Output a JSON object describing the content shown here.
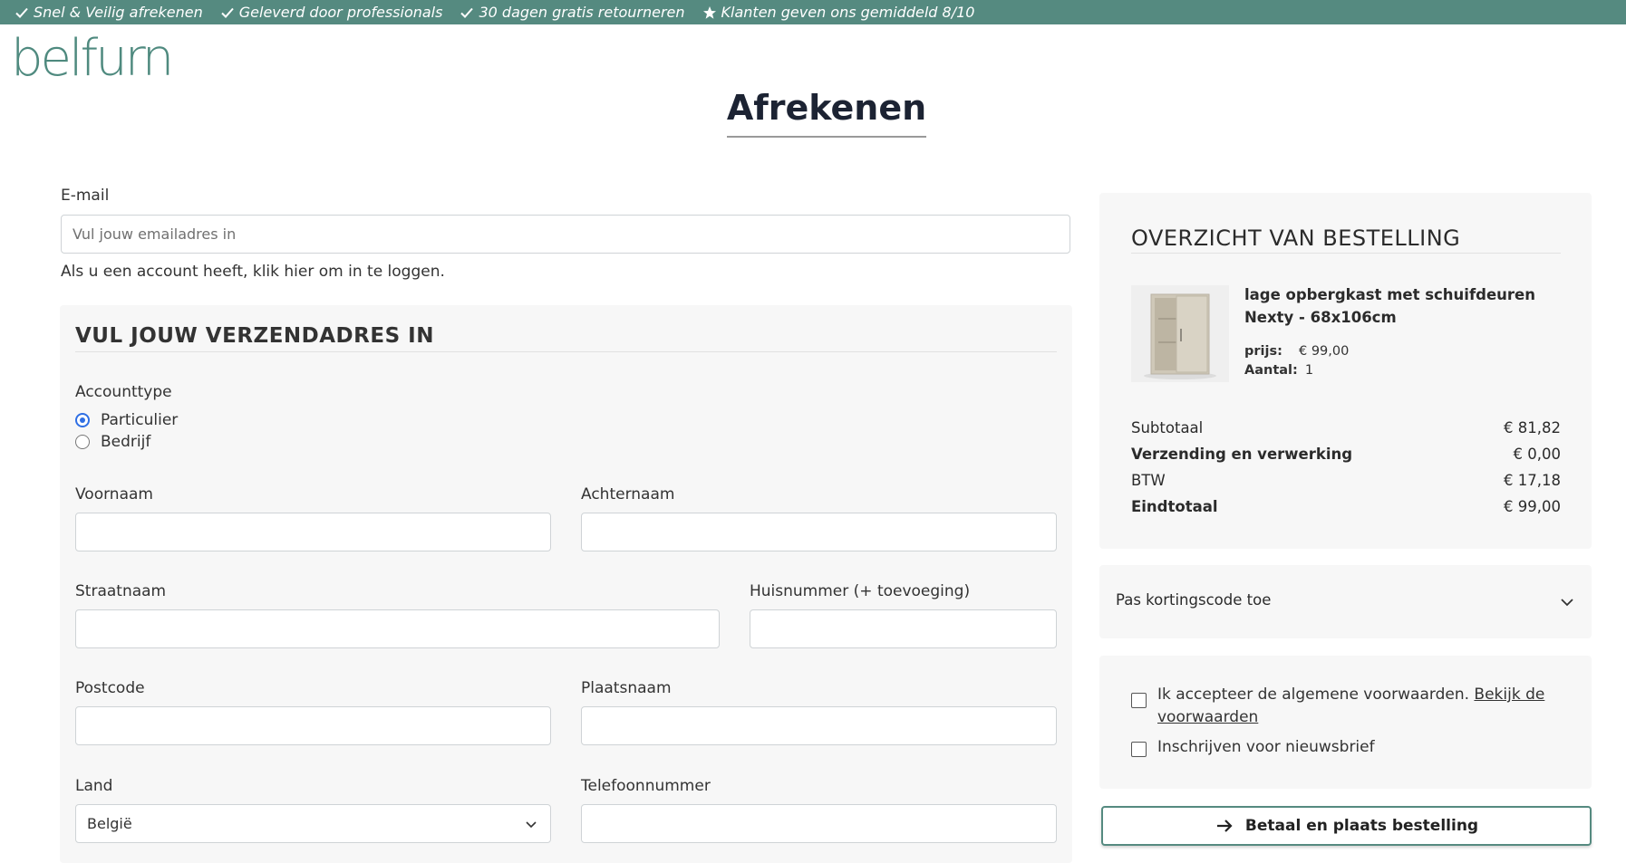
{
  "topbar": {
    "usps": [
      {
        "icon": "check-icon",
        "text": "Snel & Veilig afrekenen"
      },
      {
        "icon": "check-icon",
        "text": "Geleverd door professionals"
      },
      {
        "icon": "check-icon",
        "text": "30 dagen gratis retourneren"
      },
      {
        "icon": "star-icon",
        "text": "Klanten geven ons gemiddeld 8/10"
      }
    ]
  },
  "brand": {
    "logo": "belfurn",
    "color": "#558a80"
  },
  "page": {
    "title": "Afrekenen"
  },
  "email": {
    "label": "E-mail",
    "placeholder": "Vul jouw emailadres in",
    "value": "",
    "login_note": "Als u een account heeft, klik hier om in te loggen."
  },
  "shipping": {
    "title": "VUL JOUW VERZENDADRES IN",
    "account_type_label": "Accounttype",
    "account_types": [
      {
        "label": "Particulier",
        "selected": true
      },
      {
        "label": "Bedrijf",
        "selected": false
      }
    ],
    "fields": {
      "first_name": {
        "label": "Voornaam",
        "value": ""
      },
      "last_name": {
        "label": "Achternaam",
        "value": ""
      },
      "street": {
        "label": "Straatnaam",
        "value": ""
      },
      "house_number": {
        "label": "Huisnummer (+ toevoeging)",
        "value": ""
      },
      "postcode": {
        "label": "Postcode",
        "value": ""
      },
      "city": {
        "label": "Plaatsnaam",
        "value": ""
      },
      "country": {
        "label": "Land",
        "value": "België"
      },
      "phone": {
        "label": "Telefoonnummer",
        "value": ""
      }
    }
  },
  "summary": {
    "title": "OVERZICHT VAN BESTELLING",
    "product": {
      "name": "lage opbergkast met schuifdeuren Nexty - 68x106cm",
      "price_label": "prijs:",
      "price": "€ 99,00",
      "qty_label": "Aantal:",
      "qty": "1"
    },
    "totals": [
      {
        "label": "Subtotaal",
        "amount": "€ 81,82",
        "bold": false
      },
      {
        "label": "Verzending en verwerking",
        "amount": "€ 0,00",
        "bold": true
      },
      {
        "label": "BTW",
        "amount": "€ 17,18",
        "bold": false
      },
      {
        "label": "Eindtotaal",
        "amount": "€ 99,00",
        "bold": true
      }
    ]
  },
  "coupon": {
    "label": "Pas kortingscode toe"
  },
  "terms": {
    "accept_text": "Ik accepteer de algemene voorwaarden.",
    "link_text": "Bekijk de voorwaarden",
    "newsletter_text": "Inschrijven voor nieuwsbrief",
    "accept_checked": false,
    "newsletter_checked": false
  },
  "pay_button": {
    "label": "Betaal en plaats bestelling"
  }
}
